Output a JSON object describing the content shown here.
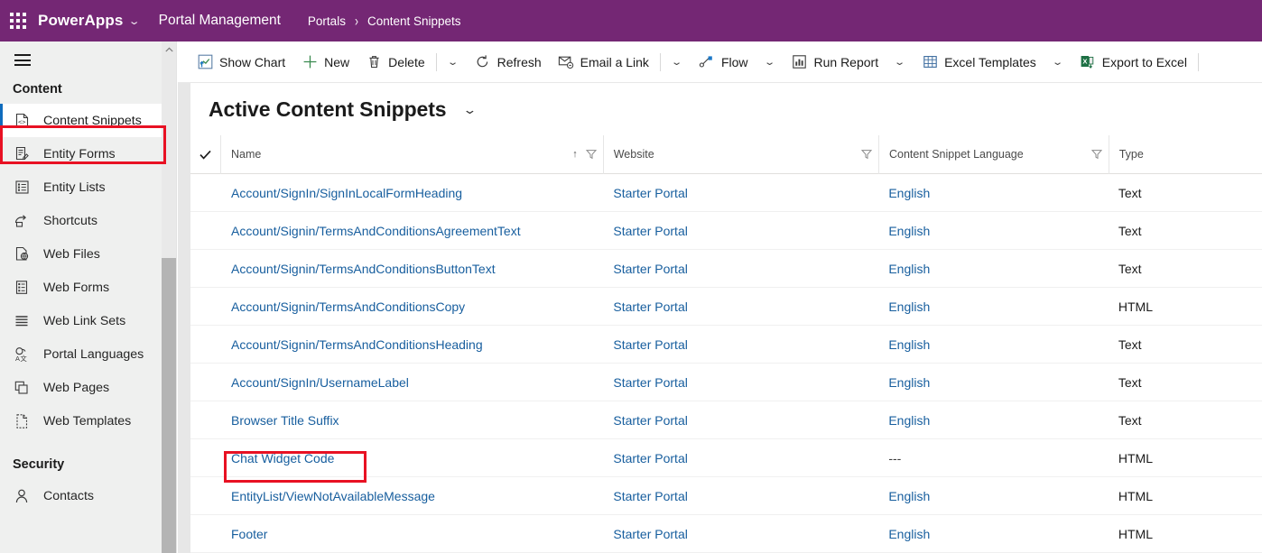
{
  "appbar": {
    "waffle_icon": "app-launcher-waffle-icon",
    "brand": "PowerApps",
    "brand_chevron": "⌄",
    "app_name": "Portal Management",
    "breadcrumb_parent": "Portals",
    "breadcrumb_separator": "›",
    "breadcrumb_current": "Content Snippets",
    "bg_color": "#742774"
  },
  "sidebar": {
    "hamburger_icon": "hamburger-menu-icon",
    "groups": [
      {
        "title": "Content",
        "items": [
          {
            "label": "Content Snippets",
            "icon": "code-file-icon",
            "selected": true
          },
          {
            "label": "Entity Forms",
            "icon": "form-edit-icon",
            "selected": false
          },
          {
            "label": "Entity Lists",
            "icon": "list-icon",
            "selected": false
          },
          {
            "label": "Shortcuts",
            "icon": "shortcut-arrow-icon",
            "selected": false
          },
          {
            "label": "Web Files",
            "icon": "globe-file-icon",
            "selected": false
          },
          {
            "label": "Web Forms",
            "icon": "web-form-icon",
            "selected": false
          },
          {
            "label": "Web Link Sets",
            "icon": "link-lines-icon",
            "selected": false
          },
          {
            "label": "Portal Languages",
            "icon": "language-icon",
            "selected": false
          },
          {
            "label": "Web Pages",
            "icon": "pages-icon",
            "selected": false
          },
          {
            "label": "Web Templates",
            "icon": "template-dashed-icon",
            "selected": false
          }
        ]
      },
      {
        "title": "Security",
        "items": [
          {
            "label": "Contacts",
            "icon": "person-icon",
            "selected": false
          }
        ]
      }
    ],
    "scrollbar_up_icon": "chevron-up-icon"
  },
  "commandbar": {
    "items": [
      {
        "label": "Show Chart",
        "icon": "show-chart-icon",
        "chevron": false
      },
      {
        "label": "New",
        "icon": "plus-icon",
        "chevron": false
      },
      {
        "label": "Delete",
        "icon": "trash-icon",
        "chevron": true,
        "separator_before_chevron": true
      },
      {
        "label": "Refresh",
        "icon": "refresh-icon",
        "chevron": false
      },
      {
        "label": "Email a Link",
        "icon": "email-link-icon",
        "chevron": true,
        "separator_before_chevron": true
      },
      {
        "label": "Flow",
        "icon": "flow-icon",
        "chevron": true
      },
      {
        "label": "Run Report",
        "icon": "run-report-icon",
        "chevron": true
      },
      {
        "label": "Excel Templates",
        "icon": "excel-grid-icon",
        "chevron": true
      },
      {
        "label": "Export to Excel",
        "icon": "excel-export-icon",
        "chevron": false
      }
    ]
  },
  "view": {
    "title": "Active Content Snippets",
    "chevron": "⌄"
  },
  "grid": {
    "select_all_icon": "checkmark-icon",
    "sort_ascending_icon": "↑",
    "filter_icon": "filter-funnel-icon",
    "columns": [
      {
        "label": "Name",
        "sorted": true
      },
      {
        "label": "Website",
        "sorted": false
      },
      {
        "label": "Content Snippet Language",
        "sorted": false
      },
      {
        "label": "Type",
        "sorted": false
      }
    ],
    "rows": [
      {
        "name": "Account/SignIn/SignInLocalFormHeading",
        "website": "Starter Portal",
        "language": "English",
        "type": "Text",
        "highlighted": false
      },
      {
        "name": "Account/Signin/TermsAndConditionsAgreementText",
        "website": "Starter Portal",
        "language": "English",
        "type": "Text",
        "highlighted": false
      },
      {
        "name": "Account/Signin/TermsAndConditionsButtonText",
        "website": "Starter Portal",
        "language": "English",
        "type": "Text",
        "highlighted": false
      },
      {
        "name": "Account/Signin/TermsAndConditionsCopy",
        "website": "Starter Portal",
        "language": "English",
        "type": "HTML",
        "highlighted": false
      },
      {
        "name": "Account/Signin/TermsAndConditionsHeading",
        "website": "Starter Portal",
        "language": "English",
        "type": "Text",
        "highlighted": false
      },
      {
        "name": "Account/SignIn/UsernameLabel",
        "website": "Starter Portal",
        "language": "English",
        "type": "Text",
        "highlighted": false
      },
      {
        "name": "Browser Title Suffix",
        "website": "Starter Portal",
        "language": "English",
        "type": "Text",
        "highlighted": false
      },
      {
        "name": "Chat Widget Code",
        "website": "Starter Portal",
        "language": "---",
        "type": "HTML",
        "highlighted": true
      },
      {
        "name": "EntityList/ViewNotAvailableMessage",
        "website": "Starter Portal",
        "language": "English",
        "type": "HTML",
        "highlighted": false
      },
      {
        "name": "Footer",
        "website": "Starter Portal",
        "language": "English",
        "type": "HTML",
        "highlighted": false
      }
    ]
  },
  "annotations": {
    "color": "#e81123",
    "sidebar_target": "Content Snippets",
    "grid_target": "Chat Widget Code"
  }
}
